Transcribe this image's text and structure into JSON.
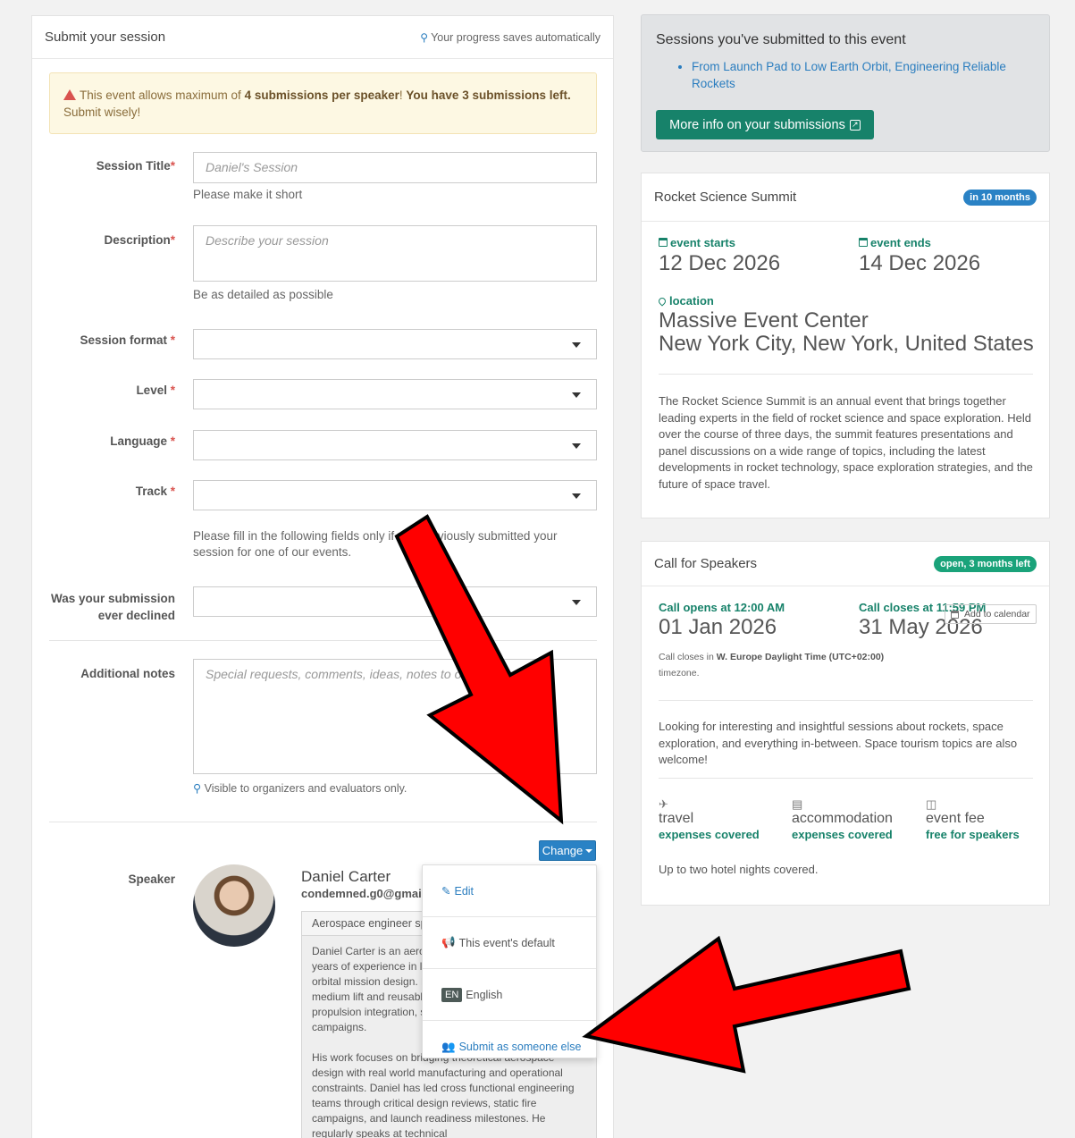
{
  "form": {
    "title": "Submit your session",
    "autosave": "Your progress saves automatically",
    "alert": {
      "prefix": "This event allows maximum of ",
      "max": "4 submissions per speaker",
      "middle": "! ",
      "left": "You have 3 submissions left.",
      "suffix": " Submit wisely!"
    },
    "session_title": {
      "label": "Session Title",
      "placeholder": "Daniel's Session",
      "help": "Please make it short"
    },
    "description": {
      "label": "Description",
      "placeholder": "Describe your session",
      "help": "Be as detailed as possible"
    },
    "session_format": {
      "label": "Session format"
    },
    "level": {
      "label": "Level"
    },
    "language": {
      "label": "Language"
    },
    "track": {
      "label": "Track"
    },
    "prev_help": "Please fill in the following fields only if you previously submitted your session for one of our events.",
    "declined": {
      "label_line1": "Was your submission",
      "label_line2": "ever declined"
    },
    "notes": {
      "label": "Additional notes",
      "placeholder": "Special requests, comments, ideas, notes to organizers...",
      "help": "Visible to organizers and evaluators only."
    },
    "speaker": {
      "label": "Speaker",
      "change_label": "Change",
      "name": "Daniel Carter",
      "email": "condemned.g0@gmail.com",
      "tagline": "Aerospace engineer specializing in launch systems",
      "bio": "Daniel Carter is an aerospace engineer with over twelve years of experience in launch vehicle development and orbital mission design. He has worked on multiple medium lift and reusable rocket programs, contributing to propulsion integration, structural analysis, and flight test campaigns.\n\nHis work focuses on bridging theoretical aerospace design with real world manufacturing and operational constraints. Daniel has led cross functional engineering teams through critical design reviews, static fire campaigns, and launch readiness milestones. He regularly speaks at technical"
    },
    "menu": {
      "edit": "Edit",
      "default": "This event's default",
      "lang_code": "EN",
      "lang": "English",
      "someone_else": "Submit as someone else"
    }
  },
  "submitted": {
    "title": "Sessions you've submitted to this event",
    "items": [
      "From Launch Pad to Low Earth Orbit, Engineering Reliable Rockets"
    ],
    "button": "More info on your submissions"
  },
  "event": {
    "name": "Rocket Science Summit",
    "badge": "in 10 months",
    "starts_label": "event starts",
    "starts": "12 Dec 2026",
    "ends_label": "event ends",
    "ends": "14 Dec 2026",
    "location_label": "location",
    "venue": "Massive Event Center",
    "city": "New York City, New York, United States",
    "description": "The Rocket Science Summit is an annual event that brings together leading experts in the field of rocket science and space exploration. Held over the course of three days, the summit features presentations and panel discussions on a wide range of topics, including the latest developments in rocket technology, space exploration strategies, and the future of space travel."
  },
  "cfs": {
    "title": "Call for Speakers",
    "badge": "open, 3 months left",
    "opens_label": "Call opens at 12:00 AM",
    "opens": "01 Jan 2026",
    "closes_label": "Call closes at 11:59 PM",
    "closes": "31 May 2026",
    "tz_prefix": "Call closes in ",
    "tz": "W. Europe Daylight Time (UTC+02:00)",
    "tz_suffix": "timezone.",
    "add_calendar": "Add to calendar",
    "description": "Looking for interesting and insightful sessions about rockets, space exploration, and everything in-between. Space tourism topics are also welcome!",
    "perks": [
      {
        "title": "travel",
        "detail": "expenses covered"
      },
      {
        "title": "accommodation",
        "detail": "expenses covered"
      },
      {
        "title": "event fee",
        "detail": "free for speakers"
      }
    ],
    "note": "Up to two hotel nights covered."
  },
  "colors": {
    "accent": "#17826a",
    "link": "#2a7dbf",
    "button": "#2a82c5",
    "arrow": "#ff0000",
    "badge_blue": "#2a82c5",
    "badge_green": "#1aa37a"
  }
}
